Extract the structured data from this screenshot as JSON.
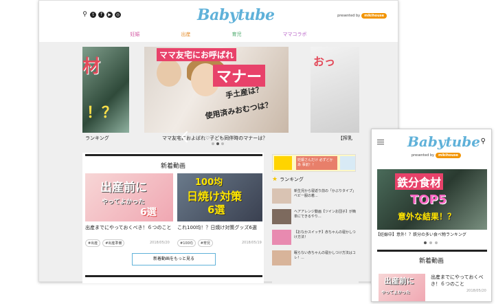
{
  "desktop": {
    "logo": "Babytube",
    "presented_by": "presented by",
    "sponsor": "mikihouse",
    "nav": [
      "妊娠",
      "出産",
      "育児",
      "ママコラボ"
    ],
    "slider": {
      "left_text_1": "材",
      "left_text_2": "！？",
      "left_caption": "ランキング",
      "center_tag": "ママ友宅にお呼ばれ",
      "center_big": "マナー",
      "center_line1": "手土産は？",
      "center_line2": "使用済みおむつは？",
      "center_caption": "ママ友宅におよばれ♡子ども同伴時のマナーは？",
      "right_text": "おっ",
      "right_caption": "【搾乳"
    },
    "new_videos": {
      "title": "新着動画",
      "items": [
        {
          "thumb_line1": "出産前に",
          "thumb_line2": "やってよかった",
          "thumb_line3": "6選",
          "title": "出産までにやっておくべき！６つのこと",
          "tags": [
            "#出産",
            "#出産準備"
          ],
          "date": "2018/05/20"
        },
        {
          "thumb_line1": "100均",
          "thumb_line2": "日焼け対策",
          "thumb_line3": "6選",
          "title": "これ100均！？日焼け対策グッズ6選",
          "tags": [
            "#100均",
            "#育児"
          ],
          "date": "2018/05/19"
        }
      ],
      "more_button": "新着動画をもっと見る"
    },
    "sidebar": {
      "ad_text": "妊娠さんだけ 必ずどかあ 事前！！",
      "ranking_title": "ランキング",
      "ranking": [
        "新生児から寝返り前の「かぶりタイプ」ベビー服の着...",
        "ヘアアレンジ動画【ツインお団子】が簡単にできるやり...",
        "【おなかスイッチ】赤ちゃんの寝かしつけ方法！",
        "眠らない赤ちゃんの寝かしつけ方法はコレ！..."
      ]
    }
  },
  "mobile": {
    "logo": "Babytube",
    "presented_by": "presented by",
    "sponsor": "mikihouse",
    "hero_line1": "鉄分食材",
    "hero_line2": "TOP5",
    "hero_line3": "意外な結果！？",
    "hero_caption": "【妊娠中】意外！？鉄分の多い食べ物ランキング",
    "section_title": "新着動画",
    "item_thumb1": "出産前に",
    "item_thumb2": "やってよかった",
    "item_title": "出産までにやっておくべき！６つのこと",
    "item_date": "2018/05/20"
  }
}
